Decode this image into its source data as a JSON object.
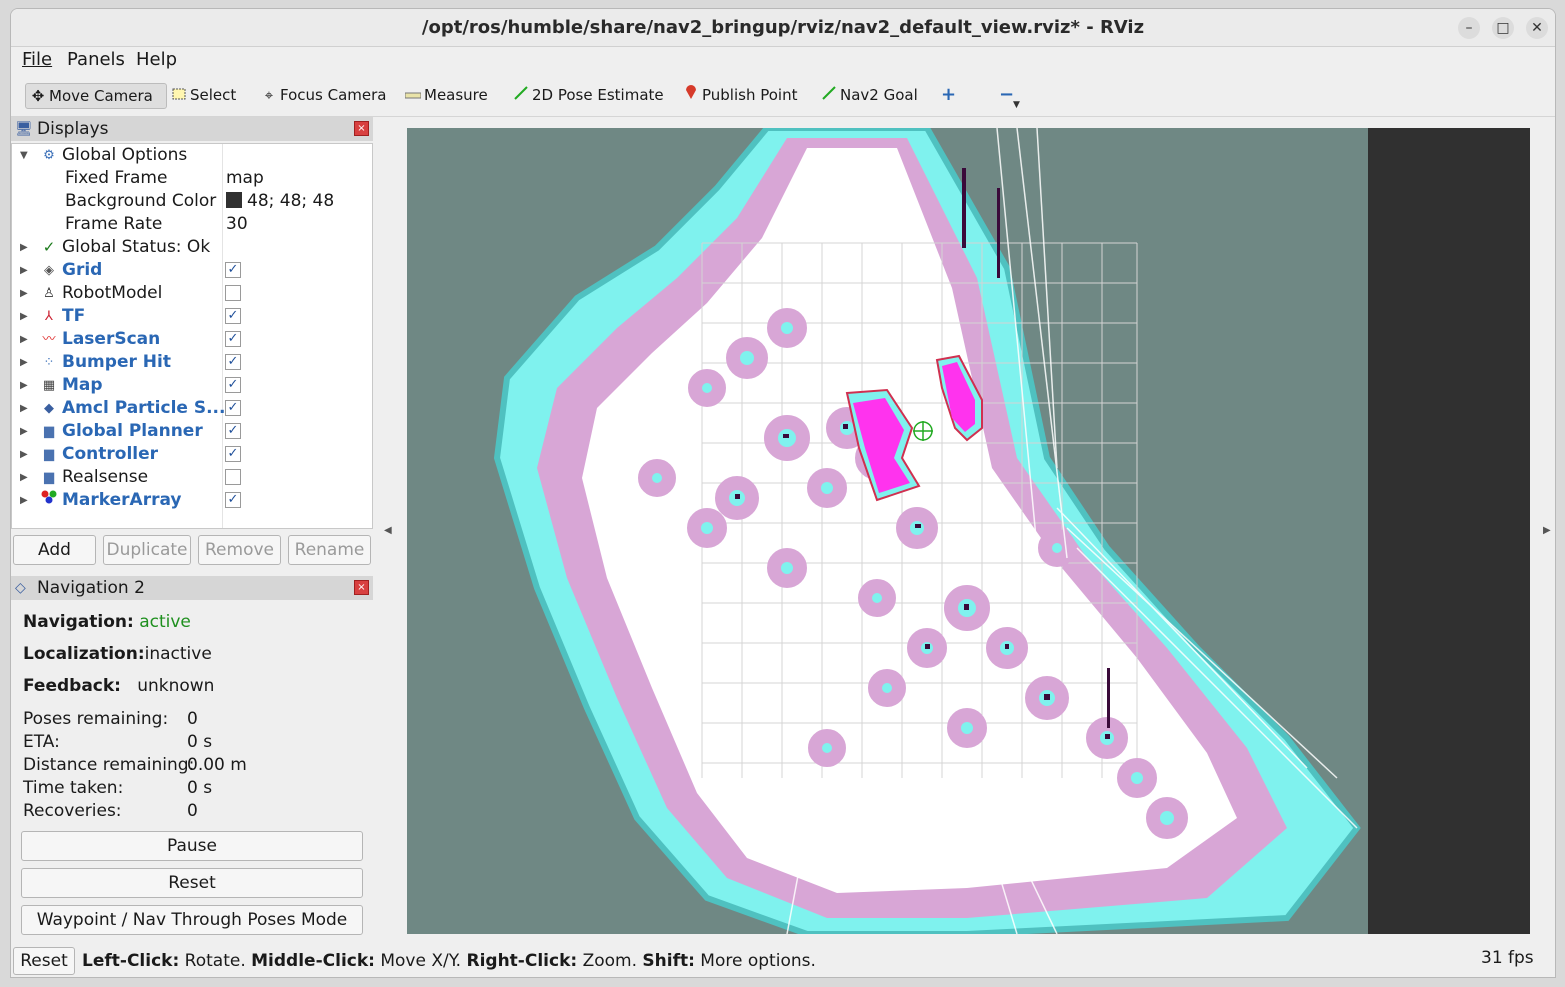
{
  "window": {
    "title": "/opt/ros/humble/share/nav2_bringup/rviz/nav2_default_view.rviz* - RViz"
  },
  "menu": [
    "File",
    "Panels",
    "Help"
  ],
  "toolbar": [
    {
      "label": "Move Camera",
      "icon": "move-camera-icon",
      "active": true
    },
    {
      "label": "Select",
      "icon": "select-icon"
    },
    {
      "label": "Focus Camera",
      "icon": "focus-camera-icon"
    },
    {
      "label": "Measure",
      "icon": "measure-icon"
    },
    {
      "label": "2D Pose Estimate",
      "icon": "pose-estimate-icon"
    },
    {
      "label": "Publish Point",
      "icon": "publish-point-icon"
    },
    {
      "label": "Nav2 Goal",
      "icon": "nav2-goal-icon"
    }
  ],
  "displays": {
    "title": "Displays",
    "global_options": {
      "label": "Global Options",
      "fixed_frame_label": "Fixed Frame",
      "fixed_frame": "map",
      "bg_label": "Background Color",
      "bg_value": "48; 48; 48",
      "frame_rate_label": "Frame Rate",
      "frame_rate": "30"
    },
    "global_status": "Global Status: Ok",
    "items": [
      {
        "label": "Grid",
        "checked": true,
        "icon": "grid-icon"
      },
      {
        "label": "RobotModel",
        "checked": false,
        "icon": "robot-model-icon"
      },
      {
        "label": "TF",
        "checked": true,
        "icon": "tf-icon"
      },
      {
        "label": "LaserScan",
        "checked": true,
        "icon": "laser-scan-icon"
      },
      {
        "label": "Bumper Hit",
        "checked": true,
        "icon": "bumper-hit-icon"
      },
      {
        "label": "Map",
        "checked": true,
        "icon": "map-icon"
      },
      {
        "label": "Amcl Particle S...",
        "checked": true,
        "icon": "amcl-particle-icon"
      },
      {
        "label": "Global Planner",
        "checked": true,
        "icon": "folder-icon"
      },
      {
        "label": "Controller",
        "checked": true,
        "icon": "folder-icon"
      },
      {
        "label": "Realsense",
        "checked": false,
        "icon": "folder-icon"
      },
      {
        "label": "MarkerArray",
        "checked": true,
        "icon": "marker-array-icon"
      }
    ],
    "buttons": {
      "add": "Add",
      "duplicate": "Duplicate",
      "remove": "Remove",
      "rename": "Rename"
    }
  },
  "nav2": {
    "title": "Navigation 2",
    "navigation_label": "Navigation:",
    "navigation_value": "active",
    "localization_label": "Localization:",
    "localization_value": "inactive",
    "feedback_label": "Feedback:",
    "feedback_value": "unknown",
    "poses_label": "Poses remaining:",
    "poses_value": "0",
    "eta_label": "ETA:",
    "eta_value": "0 s",
    "distance_label": "Distance remaining:",
    "distance_value": "0.00 m",
    "time_label": "Time taken:",
    "time_value": "0 s",
    "recoveries_label": "Recoveries:",
    "recoveries_value": "0",
    "pause": "Pause",
    "reset": "Reset",
    "mode": "Waypoint / Nav Through Poses Mode"
  },
  "status": {
    "reset": "Reset",
    "lc": "Left-Click:",
    "lc_t": " Rotate. ",
    "mc": "Middle-Click:",
    "mc_t": " Move X/Y. ",
    "rc": "Right-Click:",
    "rc_t": " Zoom. ",
    "sh": "Shift:",
    "sh_t": " More options.",
    "fps": "31 fps"
  },
  "colors": {
    "accent_blue": "#2a67b4",
    "active_green": "#1e8f1e",
    "map_gray": "#6f8884",
    "costmap_cyan": "#7ff2ee",
    "costmap_pink": "#d8a6d6",
    "robot_magenta": "#ff33ee"
  }
}
